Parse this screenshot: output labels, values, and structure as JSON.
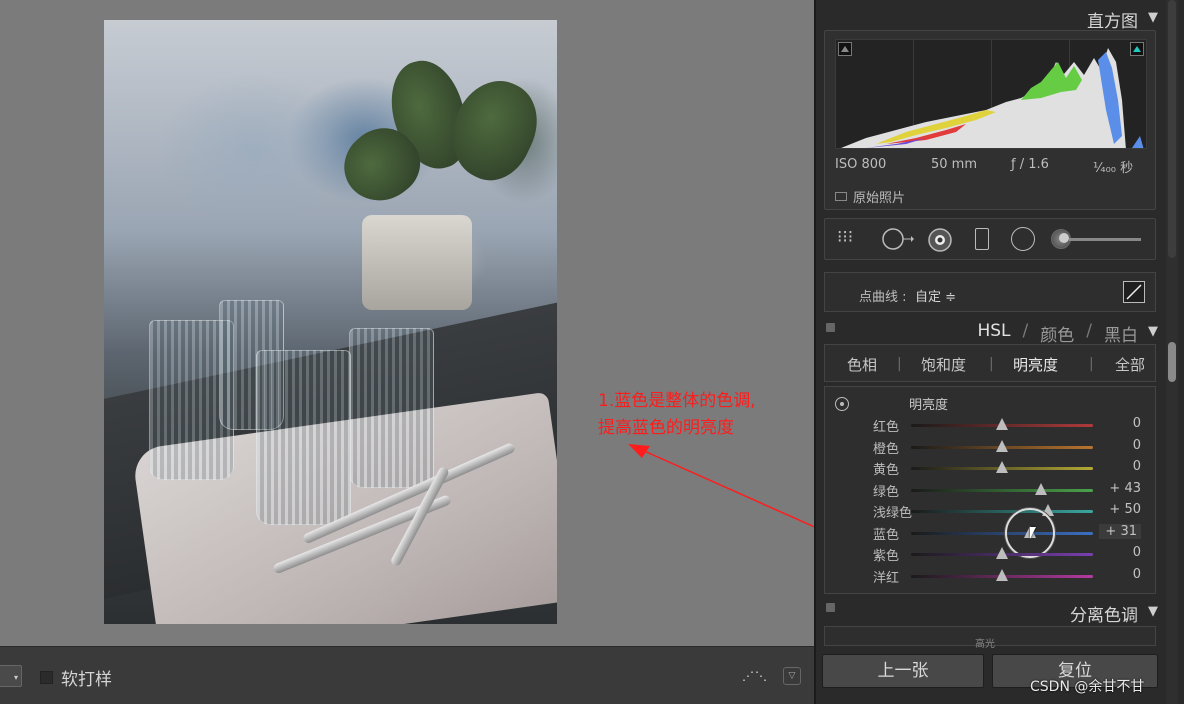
{
  "annotation": {
    "line1": "1.蓝色是整体的色调,",
    "line2": "提高蓝色的明亮度",
    "color": "#ff1c1c"
  },
  "bottom_bar": {
    "soft_proof_label": "软打样"
  },
  "histogram": {
    "title": "直方图",
    "iso": "ISO 800",
    "focal": "50 mm",
    "aperture": "ƒ / 1.6",
    "shutter": "¹⁄₄₀₀ 秒",
    "original_photo_label": "原始照片"
  },
  "tone_curve": {
    "label": "点曲线 :",
    "value": "自定 ≑"
  },
  "hsl": {
    "title_hsl": "HSL",
    "title_color": "颜色",
    "title_bw": "黑白",
    "sep": "/",
    "tabs": [
      "色相",
      "饱和度",
      "明亮度",
      "全部"
    ],
    "active_tab": "明亮度",
    "section": "明亮度",
    "rows": [
      {
        "name": "红色",
        "value": "0",
        "level": 0,
        "color": "#b03a3a"
      },
      {
        "name": "橙色",
        "value": "0",
        "level": 0,
        "color": "#b8742e"
      },
      {
        "name": "黄色",
        "value": "0",
        "level": 0,
        "color": "#b4a935"
      },
      {
        "name": "绿色",
        "value": "+ 43",
        "level": 43,
        "color": "#4aa34a"
      },
      {
        "name": "浅绿色",
        "value": "+ 50",
        "level": 50,
        "color": "#39a7a0"
      },
      {
        "name": "蓝色",
        "value": "+ 31",
        "level": 31,
        "color": "#3b6fc4"
      },
      {
        "name": "紫色",
        "value": "0",
        "level": 0,
        "color": "#7a3fb0"
      },
      {
        "name": "洋红",
        "value": "0",
        "level": 0,
        "color": "#b43aa0"
      }
    ]
  },
  "split_toning": {
    "title": "分离色调",
    "highlight": "高光"
  },
  "buttons": {
    "prev": "上一张",
    "reset": "复位"
  },
  "watermark": "CSDN @余甘不甘"
}
